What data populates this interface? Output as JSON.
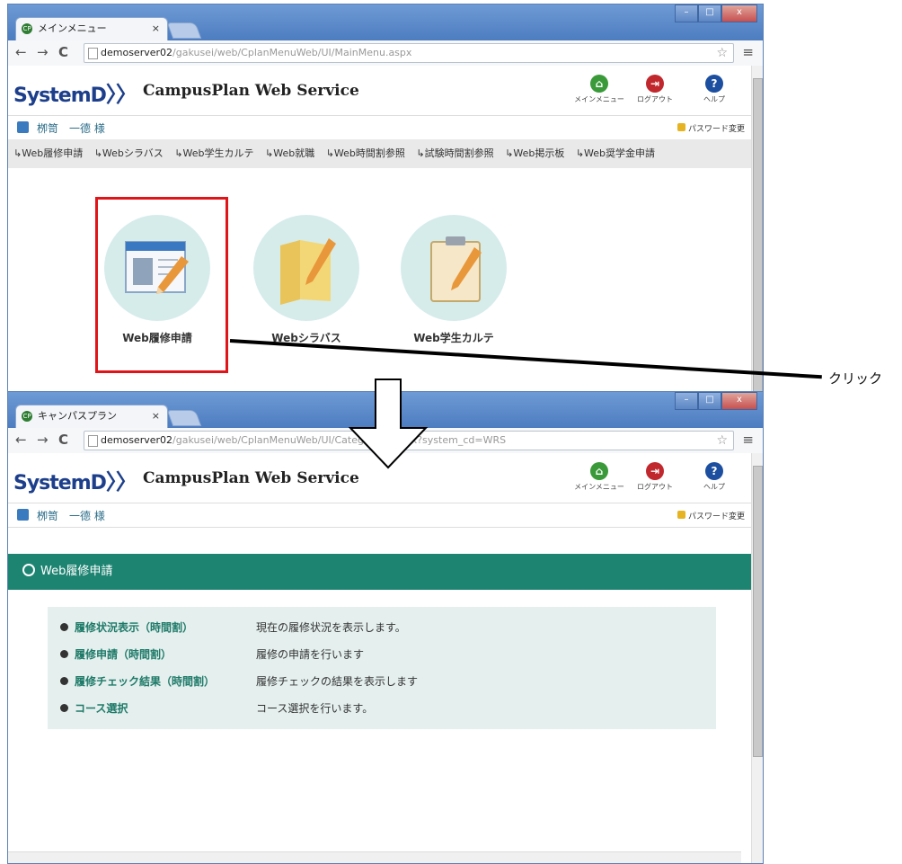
{
  "window1": {
    "tab_title": "メインメニュー",
    "tab_close": "×",
    "url_host": "demoserver02",
    "url_path": "/gakusei/web/CplanMenuWeb/UI/MainMenu.aspx",
    "logo": "SystemD",
    "app_title": "CampusPlan Web Service",
    "header_icons": [
      {
        "label": "メインメニュー",
        "color": "#3a9a3a"
      },
      {
        "label": "ログアウト",
        "color": "#c0282d"
      },
      {
        "label": "ヘルプ",
        "color": "#1d4fa0"
      }
    ],
    "user_name": "栁笥　一德 様",
    "password_link": "パスワード変更",
    "subnav": [
      "↳Web履修申請",
      "↳Webシラバス",
      "↳Web学生カルテ",
      "↳Web就職",
      "↳Web時間割参照",
      "↳試験時間割参照",
      "↳Web掲示板",
      "↳Web奨学金申請"
    ],
    "tiles": [
      {
        "label": "Web履修申請",
        "icon": "course-registration-icon"
      },
      {
        "label": "Webシラバス",
        "icon": "folder-pencil-icon"
      },
      {
        "label": "Web学生カルテ",
        "icon": "clipboard-pencil-icon"
      }
    ]
  },
  "annotation": {
    "click_label": "クリック"
  },
  "window2": {
    "tab_title": "キャンパスプラン",
    "tab_close": "×",
    "url_host": "demoserver02",
    "url_path": "/gakusei/web/CplanMenuWeb/UI/Catego",
    "url_path_tail": "x?system_cd=WRS",
    "logo": "SystemD",
    "app_title": "CampusPlan Web Service",
    "header_icons": [
      {
        "label": "メインメニュー",
        "color": "#3a9a3a"
      },
      {
        "label": "ログアウト",
        "color": "#c0282d"
      },
      {
        "label": "ヘルプ",
        "color": "#1d4fa0"
      }
    ],
    "user_name": "栁笥　一德 様",
    "password_link": "パスワード変更",
    "section_title": "Web履修申請",
    "functions": [
      {
        "name": "履修状況表示（時間割）",
        "desc": "現在の履修状況を表示します。"
      },
      {
        "name": "履修申請（時間割）",
        "desc": "履修の申請を行います"
      },
      {
        "name": "履修チェック結果（時間割）",
        "desc": "履修チェックの結果を表示します"
      },
      {
        "name": "コース選択",
        "desc": "コース選択を行います。"
      }
    ]
  }
}
